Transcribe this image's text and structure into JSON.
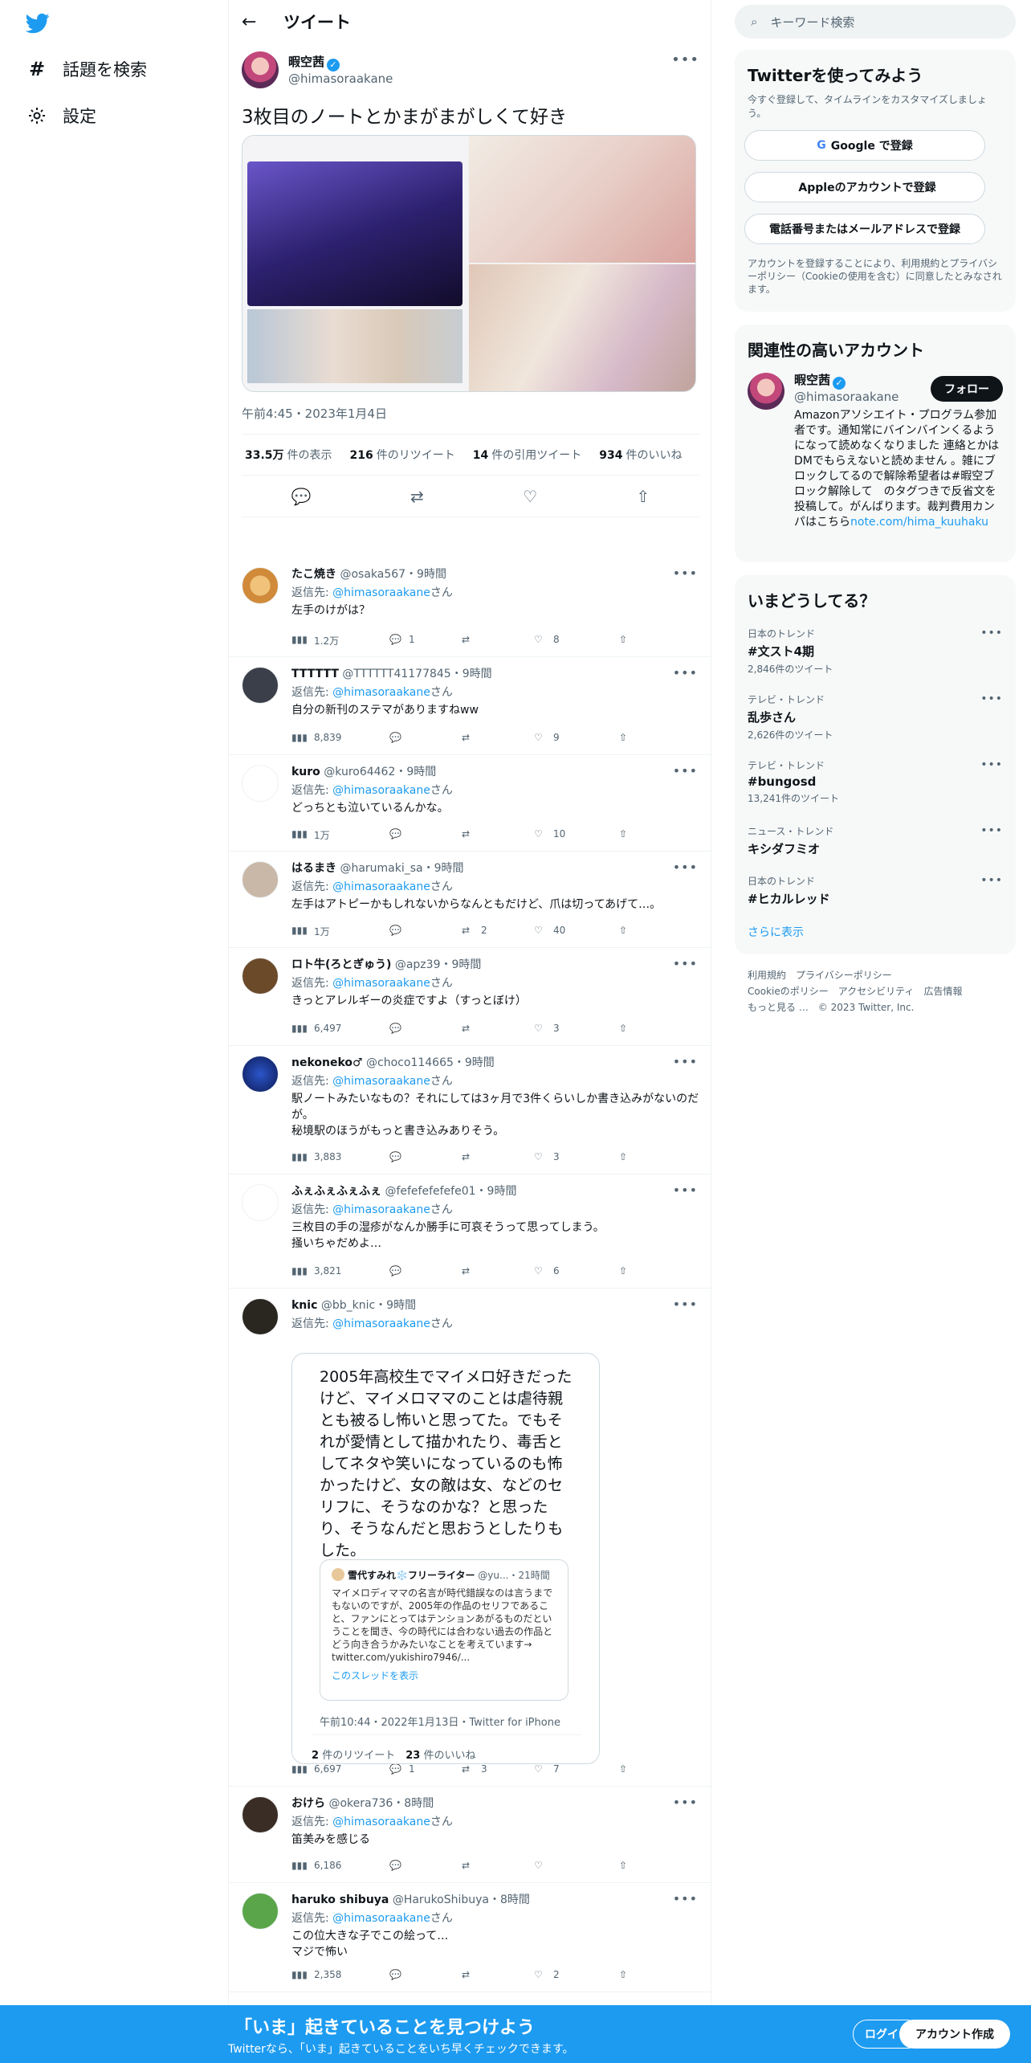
{
  "nav": {
    "explore": "話題を検索",
    "settings": "設定"
  },
  "header": {
    "title": "ツイート"
  },
  "tweet": {
    "name": "暇空茜",
    "handle": "@himasoraakane",
    "text": "3枚目のノートとかまがまがしくて好き",
    "time": "午前4:45・2023年1月4日",
    "views_n": "33.5万",
    "views_l": "件の表示",
    "rt_n": "216",
    "rt_l": "件のリツイート",
    "qt_n": "14",
    "qt_l": "件の引用ツイート",
    "like_n": "934",
    "like_l": "件のいいね"
  },
  "replies": [
    {
      "name": "たこ焼き",
      "handle": "@osaka567",
      "time": "・9時間",
      "to_prefix": "返信先: ",
      "to": "@himasoraakane",
      "to_suffix": "さん",
      "text": "左手のけがは？",
      "views": "1.2万",
      "replies": "1",
      "rts": "",
      "likes": "8"
    },
    {
      "name": "TTTTTT",
      "handle": "@TTTTTT41177845",
      "time": "・9時間",
      "to_prefix": "返信先: ",
      "to": "@himasoraakane",
      "to_suffix": "さん",
      "text": "自分の新刊のステマがありますねww",
      "views": "8,839",
      "replies": "",
      "rts": "",
      "likes": "9"
    },
    {
      "name": "kuro",
      "handle": "@kuro64462",
      "time": "・9時間",
      "to_prefix": "返信先: ",
      "to": "@himasoraakane",
      "to_suffix": "さん",
      "text": "どっちとも泣いているんかな。",
      "views": "1万",
      "replies": "",
      "rts": "",
      "likes": "10"
    },
    {
      "name": "はるまき",
      "handle": "@harumaki_sa",
      "time": "・9時間",
      "to_prefix": "返信先: ",
      "to": "@himasoraakane",
      "to_suffix": "さん",
      "text": "左手はアトピーかもしれないからなんともだけど、爪は切ってあげて…。",
      "views": "1万",
      "replies": "",
      "rts": "2",
      "likes": "40"
    },
    {
      "name": "ロト牛(ろとぎゅう)",
      "handle": "@apz39",
      "time": "・9時間",
      "to_prefix": "返信先: ",
      "to": "@himasoraakane",
      "to_suffix": "さん",
      "text": "きっとアレルギーの炎症ですよ（すっとぼけ）",
      "views": "6,497",
      "replies": "",
      "rts": "",
      "likes": "3"
    },
    {
      "name": "nekoneko♂",
      "handle": "@choco114665",
      "time": "・9時間",
      "to_prefix": "返信先: ",
      "to": "@himasoraakane",
      "to_suffix": "さん",
      "text": "駅ノートみたいなもの？それにしては3ヶ月で3件くらいしか書き込みがないのだが。\n秘境駅のほうがもっと書き込みありそう。",
      "views": "3,883",
      "replies": "",
      "rts": "",
      "likes": "3"
    },
    {
      "name": "ふぇふぇふぇふぇ",
      "handle": "@fefefefefefe01",
      "time": "・9時間",
      "to_prefix": "返信先: ",
      "to": "@himasoraakane",
      "to_suffix": "さん",
      "text": "三枚目の手の湿疹がなんか勝手に可哀そうって思ってしまう。\n掻いちゃだめよ…",
      "views": "3,821",
      "replies": "",
      "rts": "",
      "likes": "6"
    },
    {
      "name": "knic",
      "handle": "@bb_knic",
      "time": "・9時間",
      "to_prefix": "返信先: ",
      "to": "@himasoraakane",
      "to_suffix": "さん",
      "text": "",
      "views": "6,697",
      "replies": "1",
      "rts": "3",
      "likes": "7"
    },
    {
      "name": "おけら",
      "handle": "@okera736",
      "time": "・8時間",
      "to_prefix": "返信先: ",
      "to": "@himasoraakane",
      "to_suffix": "さん",
      "text": "笛美みを感じる",
      "views": "6,186",
      "replies": "",
      "rts": "",
      "likes": ""
    },
    {
      "name": "haruko shibuya",
      "handle": "@HarukoShibuya",
      "time": "・8時間",
      "to_prefix": "返信先: ",
      "to": "@himasoraakane",
      "to_suffix": "さん",
      "text": "この位大きな子でこの絵って…\nマジで怖い",
      "views": "2,358",
      "replies": "",
      "rts": "",
      "likes": "2"
    }
  ],
  "quote": {
    "body": "2005年高校生でマイメロ好きだったけど、マイメロママのことは虐待親とも被るし怖いと思ってた。でもそれが愛情として描かれたり、毒舌としてネタや笑いになっているのも怖かったけど、女の敵は女、などのセリフに、そうなのかな？と思ったり、そうなんだと思おうとしたりもした。",
    "inner_name": "雪代すみれ❄️フリーライター",
    "inner_handle": "@yu...",
    "inner_time": "・21時間",
    "inner_text": "マイメロディママの名言が時代錯誤なのは言うまでもないのですが、2005年の作品のセリフであること、ファンにとってはテンションあがるものだということを聞き、今の時代には合わない過去の作品とどう向き合うかみたいなことを考えています→ twitter.com/yukishiro7946/...",
    "inner_link": "このスレッドを表示",
    "meta": "午前10:44・2022年1月13日・Twitter for iPhone",
    "rt_n": "2",
    "rt_l": "件のリツイート",
    "like_n": "23",
    "like_l": "件のいいね"
  },
  "search": {
    "placeholder": "キーワード検索"
  },
  "signup": {
    "title": "Twitterを使ってみよう",
    "desc": "今すぐ登録して、タイムラインをカスタマイズしましょう。",
    "google": "Google で登録",
    "apple": "Appleのアカウントで登録",
    "phone": "電話番号またはメールアドレスで登録",
    "legal": "アカウントを登録することにより、利用規約とプライバシーポリシー（Cookieの使用を含む）に同意したとみなされます。"
  },
  "related": {
    "title": "関連性の高いアカウント",
    "name": "暇空茜",
    "handle": "@himasoraakane",
    "follow": "フォロー",
    "bio": "Amazonアソシエイト・プログラム参加者です。通知常にバインバインくるようになって読めなくなりました 連絡とかはDMでもらえないと読めません 。雑にブロックしてるので解除希望者は#暇空ブロック解除して　のタグつきで反省文を投稿して。がんばります。裁判費用カンパはこちら",
    "link": "note.com/hima_kuuhaku"
  },
  "trends": {
    "title": "いまどうしてる？",
    "items": [
      {
        "cat": "日本のトレンド",
        "name": "#文スト4期",
        "count": "2,846件のツイート"
      },
      {
        "cat": "テレビ・トレンド",
        "name": "乱歩さん",
        "count": "2,626件のツイート"
      },
      {
        "cat": "テレビ・トレンド",
        "name": "#bungosd",
        "count": "13,241件のツイート"
      },
      {
        "cat": "ニュース・トレンド",
        "name": "キシダフミオ",
        "count": ""
      },
      {
        "cat": "日本のトレンド",
        "name": "#ヒカルレッド",
        "count": ""
      }
    ],
    "more": "さらに表示"
  },
  "footer_links": {
    "terms": "利用規約",
    "privacy": "プライバシーポリシー",
    "cookie": "Cookieのポリシー",
    "access": "アクセシビリティ",
    "ads": "広告情報",
    "more": "もっと見る …",
    "copy": "© 2023 Twitter, Inc."
  },
  "banner": {
    "title": "「いま」起きていることを見つけよう",
    "sub": "Twitterなら、「いま」起きていることをいち早くチェックできます。",
    "login": "ログイン",
    "signup": "アカウント作成"
  },
  "colors": {
    "accent": "#1d9bf0",
    "text": "#0f1419",
    "muted": "#536471"
  }
}
